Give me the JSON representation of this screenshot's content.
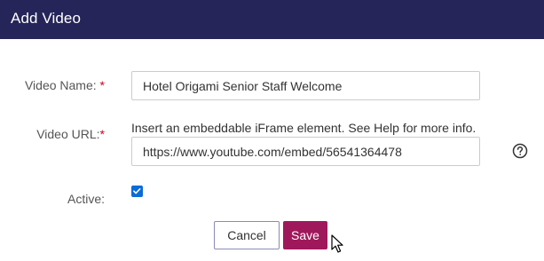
{
  "dialog": {
    "title": "Add Video"
  },
  "form": {
    "video_name": {
      "label": "Video Name:",
      "required_mark": "*",
      "value": "Hotel Origami Senior Staff Welcome"
    },
    "video_url": {
      "label": "Video URL:",
      "required_mark": "*",
      "hint": "Insert an embeddable iFrame element. See Help for more info.",
      "value": "https://www.youtube.com/embed/56541364478",
      "help_icon": "question-circle-icon"
    },
    "active": {
      "label": "Active:",
      "checked": true
    }
  },
  "buttons": {
    "cancel_label": "Cancel",
    "save_label": "Save"
  },
  "colors": {
    "header_bg": "#25255a",
    "required": "#d0021b",
    "save_bg": "#a0185c",
    "checkbox": "#0a6cd6"
  }
}
